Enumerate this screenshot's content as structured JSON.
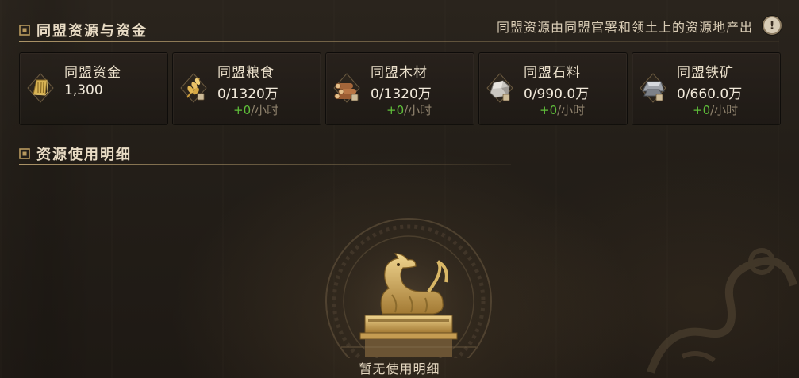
{
  "resources_section": {
    "title": "同盟资源与资金",
    "info_text": "同盟资源由同盟官署和领土上的资源地产出",
    "info_icon_glyph": "!"
  },
  "cards": [
    {
      "icon": "gold-ingot-icon",
      "name": "同盟资金",
      "amount": "1,300",
      "rate_plus": "",
      "rate_unit": ""
    },
    {
      "icon": "grain-icon",
      "name": "同盟粮食",
      "amount": "0/1320万",
      "rate_plus": "+0",
      "rate_unit": "/小时"
    },
    {
      "icon": "wood-logs-icon",
      "name": "同盟木材",
      "amount": "0/1320万",
      "rate_plus": "+0",
      "rate_unit": "/小时"
    },
    {
      "icon": "stone-icon",
      "name": "同盟石料",
      "amount": "0/990.0万",
      "rate_plus": "+0",
      "rate_unit": "/小时"
    },
    {
      "icon": "iron-ore-icon",
      "name": "同盟铁矿",
      "amount": "0/660.0万",
      "rate_plus": "+0",
      "rate_unit": "/小时"
    }
  ],
  "usage_section": {
    "title": "资源使用明细",
    "empty_text": "暂无使用明细"
  },
  "colors": {
    "rate_green": "#5fbf3a",
    "text_light": "#eadfca",
    "gold": "#c9a252"
  }
}
